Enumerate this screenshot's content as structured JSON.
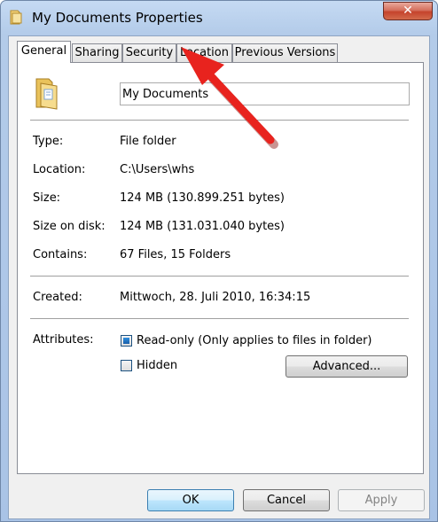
{
  "window": {
    "title": "My Documents Properties",
    "close_glyph": "✕"
  },
  "tabs": [
    {
      "label": "General",
      "active": true
    },
    {
      "label": "Sharing"
    },
    {
      "label": "Security"
    },
    {
      "label": "Location"
    },
    {
      "label": "Previous Versions"
    }
  ],
  "general": {
    "folder_icon": "folder-icon",
    "name_value": "My Documents",
    "rows": [
      {
        "label": "Type:",
        "value": "File folder"
      },
      {
        "label": "Location:",
        "value": "C:\\Users\\whs"
      },
      {
        "label": "Size:",
        "value": "124 MB (130.899.251 bytes)"
      },
      {
        "label": "Size on disk:",
        "value": "124 MB (131.031.040 bytes)"
      },
      {
        "label": "Contains:",
        "value": "67 Files, 15 Folders"
      }
    ],
    "created_label": "Created:",
    "created_value": "Mittwoch, 28. Juli 2010, 16:34:15",
    "attributes_label": "Attributes:",
    "readonly_label": "Read-only (Only applies to files in folder)",
    "readonly_state": "indeterminate",
    "hidden_label": "Hidden",
    "hidden_checked": false,
    "advanced_label": "Advanced..."
  },
  "buttons": {
    "ok": "OK",
    "cancel": "Cancel",
    "apply": "Apply"
  },
  "colors": {
    "annotation_arrow": "#e8231e",
    "titlebar": "#b9d1ee",
    "close_button": "#c94a32"
  }
}
